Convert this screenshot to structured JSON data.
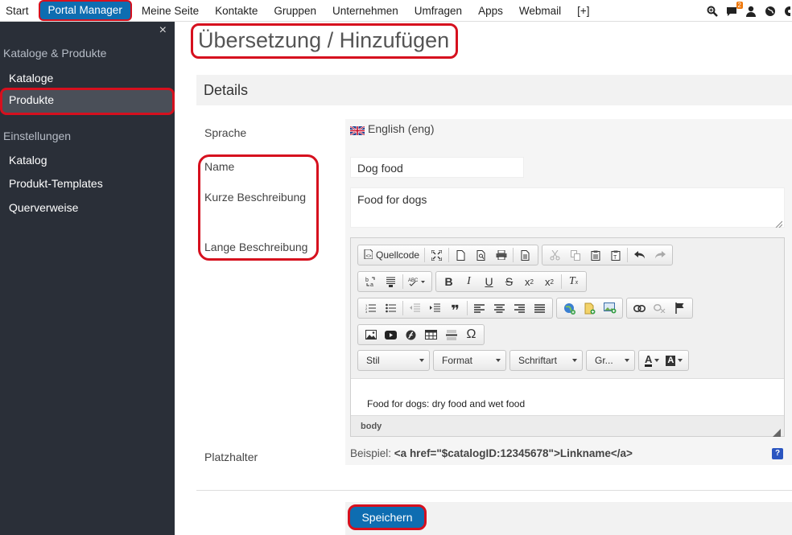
{
  "nav": {
    "items": [
      "Start",
      "Portal Manager",
      "Meine Seite",
      "Kontakte",
      "Gruppen",
      "Unternehmen",
      "Umfragen",
      "Apps",
      "Webmail",
      "[+]"
    ],
    "active_index": 1,
    "chat_badge": "2"
  },
  "sidebar": {
    "close": "×",
    "section1": "Kataloge & Produkte",
    "item_kataloge": "Kataloge",
    "item_produkte": "Produkte",
    "section2": "Einstellungen",
    "item_katalog": "Katalog",
    "item_templates": "Produkt-Templates",
    "item_querverweise": "Querverweise"
  },
  "page": {
    "title": "Übersetzung / Hinzufügen",
    "details_heading": "Details"
  },
  "form": {
    "language_label": "Sprache",
    "language_value": "English (eng)",
    "name_label": "Name",
    "name_value": "Dog food",
    "short_desc_label": "Kurze Beschreibung",
    "short_desc_value": "Food for dogs",
    "long_desc_label": "Lange Beschreibung",
    "placeholder_label": "Platzhalter",
    "placeholder_prefix": "Beispiel:",
    "placeholder_example": "<a href=\"$catalogID:12345678\">Linkname</a>",
    "help": "?"
  },
  "editor": {
    "source_label": "Quellcode",
    "combo_style": "Stil",
    "combo_format": "Format",
    "combo_font": "Schriftart",
    "combo_size": "Gr...",
    "font_color_label": "A",
    "bg_color_label": "A",
    "content": "Food for dogs: dry food and wet food",
    "path": "body"
  },
  "actions": {
    "save": "Speichern"
  }
}
